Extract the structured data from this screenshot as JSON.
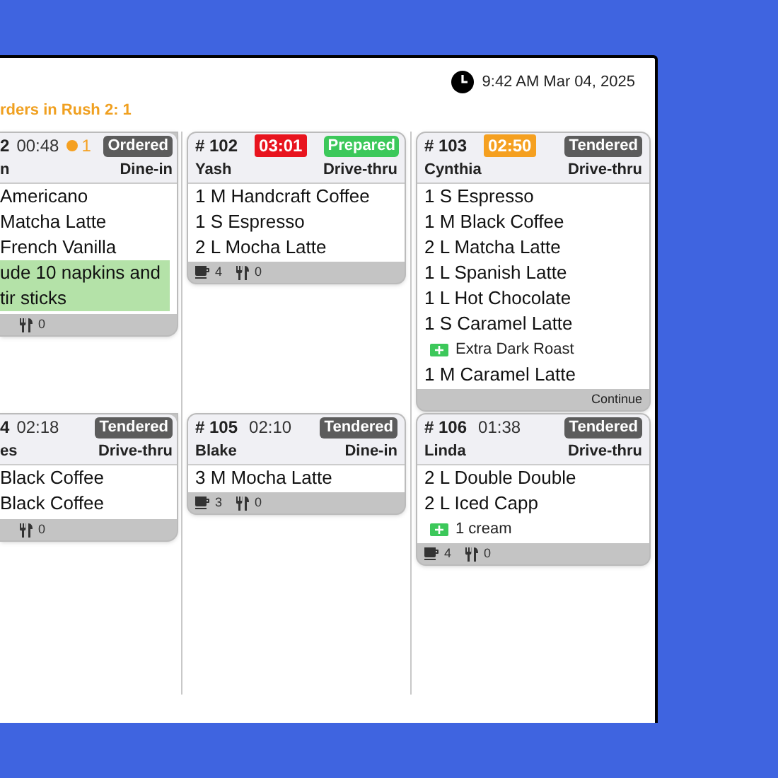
{
  "clock": {
    "time": "9:42 AM Mar 04, 2025"
  },
  "rush": "rders in Rush 2: 1",
  "columns": [
    {
      "cards": [
        {
          "number": "2",
          "timer": {
            "text": "00:48",
            "kind": "normal"
          },
          "alert": "1",
          "status": {
            "text": "Ordered",
            "kind": "neutral"
          },
          "name": "n",
          "type": "Dine-in",
          "lines": [
            {
              "kind": "item",
              "text": "Americano"
            },
            {
              "kind": "item",
              "text": "Matcha Latte"
            },
            {
              "kind": "item",
              "text": "French Vanilla"
            },
            {
              "kind": "note",
              "text": "ude 10 napkins and tir sticks"
            }
          ],
          "footer": [
            {
              "kind": "utensils",
              "count": "0"
            }
          ]
        },
        {
          "number": "4",
          "timer": {
            "text": "02:18",
            "kind": "normal"
          },
          "status": {
            "text": "Tendered",
            "kind": "neutral"
          },
          "name": "es",
          "type": "Drive-thru",
          "lines": [
            {
              "kind": "item",
              "text": "Black Coffee"
            },
            {
              "kind": "item",
              "text": "Black Coffee"
            }
          ],
          "footer": [
            {
              "kind": "utensils",
              "count": "0"
            }
          ]
        }
      ]
    },
    {
      "cards": [
        {
          "number": "# 102",
          "timer": {
            "text": "03:01",
            "kind": "overdue"
          },
          "status": {
            "text": "Prepared",
            "kind": "done"
          },
          "name": "Yash",
          "type": "Drive-thru",
          "lines": [
            {
              "kind": "item",
              "text": "1 M Handcraft Coffee"
            },
            {
              "kind": "item",
              "text": "1 S Espresso"
            },
            {
              "kind": "item",
              "text": "2 L Mocha Latte"
            }
          ],
          "footer": [
            {
              "kind": "cup",
              "count": "4"
            },
            {
              "kind": "utensils",
              "count": "0"
            }
          ]
        },
        {
          "number": "# 105",
          "timer": {
            "text": "02:10",
            "kind": "normal"
          },
          "status": {
            "text": "Tendered",
            "kind": "neutral"
          },
          "name": "Blake",
          "type": "Dine-in",
          "lines": [
            {
              "kind": "item",
              "text": "3 M Mocha Latte"
            }
          ],
          "footer": [
            {
              "kind": "cup",
              "count": "3"
            },
            {
              "kind": "utensils",
              "count": "0"
            }
          ]
        }
      ]
    },
    {
      "cards": [
        {
          "number": "# 103",
          "timer": {
            "text": "02:50",
            "kind": "warning"
          },
          "status": {
            "text": "Tendered",
            "kind": "neutral"
          },
          "name": "Cynthia",
          "type": "Drive-thru",
          "lines": [
            {
              "kind": "item",
              "text": "1 S Espresso"
            },
            {
              "kind": "item",
              "text": "1 M Black Coffee"
            },
            {
              "kind": "item",
              "text": "2 L Matcha Latte"
            },
            {
              "kind": "item",
              "text": "1 L Spanish Latte"
            },
            {
              "kind": "item",
              "text": "1 L Hot Chocolate"
            },
            {
              "kind": "item",
              "text": "1 S Caramel Latte"
            },
            {
              "kind": "modifier",
              "text": "Extra Dark Roast"
            },
            {
              "kind": "item",
              "text": "1 M Caramel Latte"
            }
          ],
          "footer": [
            {
              "kind": "continue",
              "text": "Continue"
            }
          ]
        },
        {
          "number": "# 106",
          "timer": {
            "text": "01:38",
            "kind": "normal"
          },
          "status": {
            "text": "Tendered",
            "kind": "neutral"
          },
          "name": "Linda",
          "type": "Drive-thru",
          "lines": [
            {
              "kind": "item",
              "text": "2 L Double Double"
            },
            {
              "kind": "item",
              "text": "2 L Iced Capp"
            },
            {
              "kind": "modifier",
              "text": "1 cream"
            }
          ],
          "footer": [
            {
              "kind": "cup",
              "count": "4"
            },
            {
              "kind": "utensils",
              "count": "0"
            }
          ]
        }
      ]
    }
  ]
}
